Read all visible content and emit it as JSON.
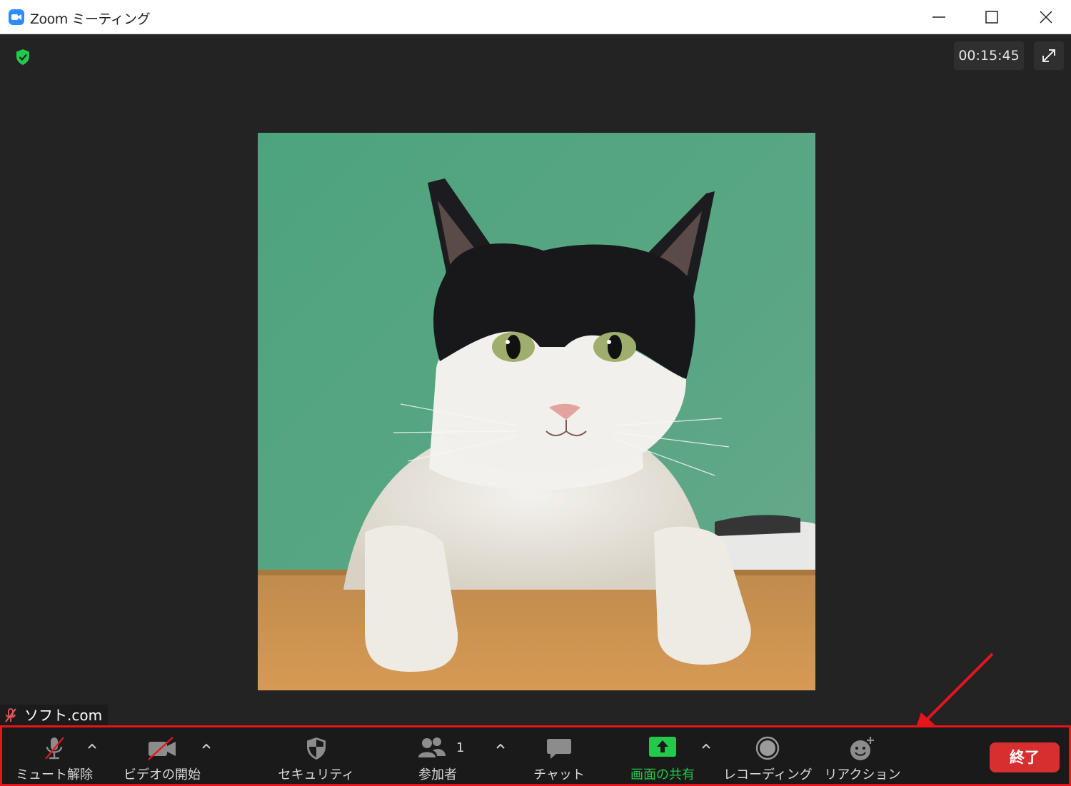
{
  "window": {
    "title": "Zoom ミーティング",
    "controls": {
      "minimize": "minimize",
      "maximize": "maximize",
      "close": "close"
    }
  },
  "meeting": {
    "elapsed_time": "00:15:45",
    "participant_name": "ソフト.com",
    "encryption_status_color": "#23c94b"
  },
  "toolbar": {
    "unmute_label": "ミュート解除",
    "start_video_label": "ビデオの開始",
    "security_label": "セキュリティ",
    "participants_label": "参加者",
    "participants_count": "1",
    "chat_label": "チャット",
    "share_screen_label": "画面の共有",
    "recording_label": "レコーディング",
    "reactions_label": "リアクション",
    "end_label": "終了"
  },
  "colors": {
    "share_green": "#23c94b",
    "end_red": "#d72f2f",
    "highlight_red": "#e8141b",
    "zoom_blue": "#2d8cff"
  }
}
